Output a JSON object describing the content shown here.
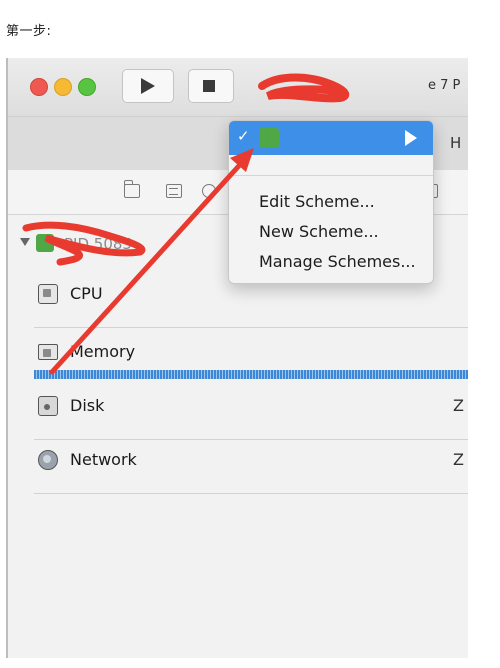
{
  "step_title": "第一步:",
  "toolbar": {
    "right_partial_text": "e 7 P"
  },
  "tabstrip": {
    "partial_tab": "H"
  },
  "process": {
    "label": "PID 5085"
  },
  "gauges": [
    {
      "label": "CPU",
      "icon": "cpu-icon",
      "value": ""
    },
    {
      "label": "Memory",
      "icon": "memory-icon",
      "value": ""
    },
    {
      "label": "Disk",
      "icon": "disk-icon",
      "value": "Z"
    },
    {
      "label": "Network",
      "icon": "network-icon",
      "value": "Z"
    }
  ],
  "scheme_menu": {
    "selected_scheme_checked": true,
    "items": [
      {
        "label": "Edit Scheme..."
      },
      {
        "label": "New Scheme..."
      },
      {
        "label": "Manage Schemes..."
      }
    ]
  },
  "colors": {
    "menu_highlight": "#3d8fe8",
    "annotation_red": "#e83a2f",
    "memory_bar": "#3c87d6"
  }
}
